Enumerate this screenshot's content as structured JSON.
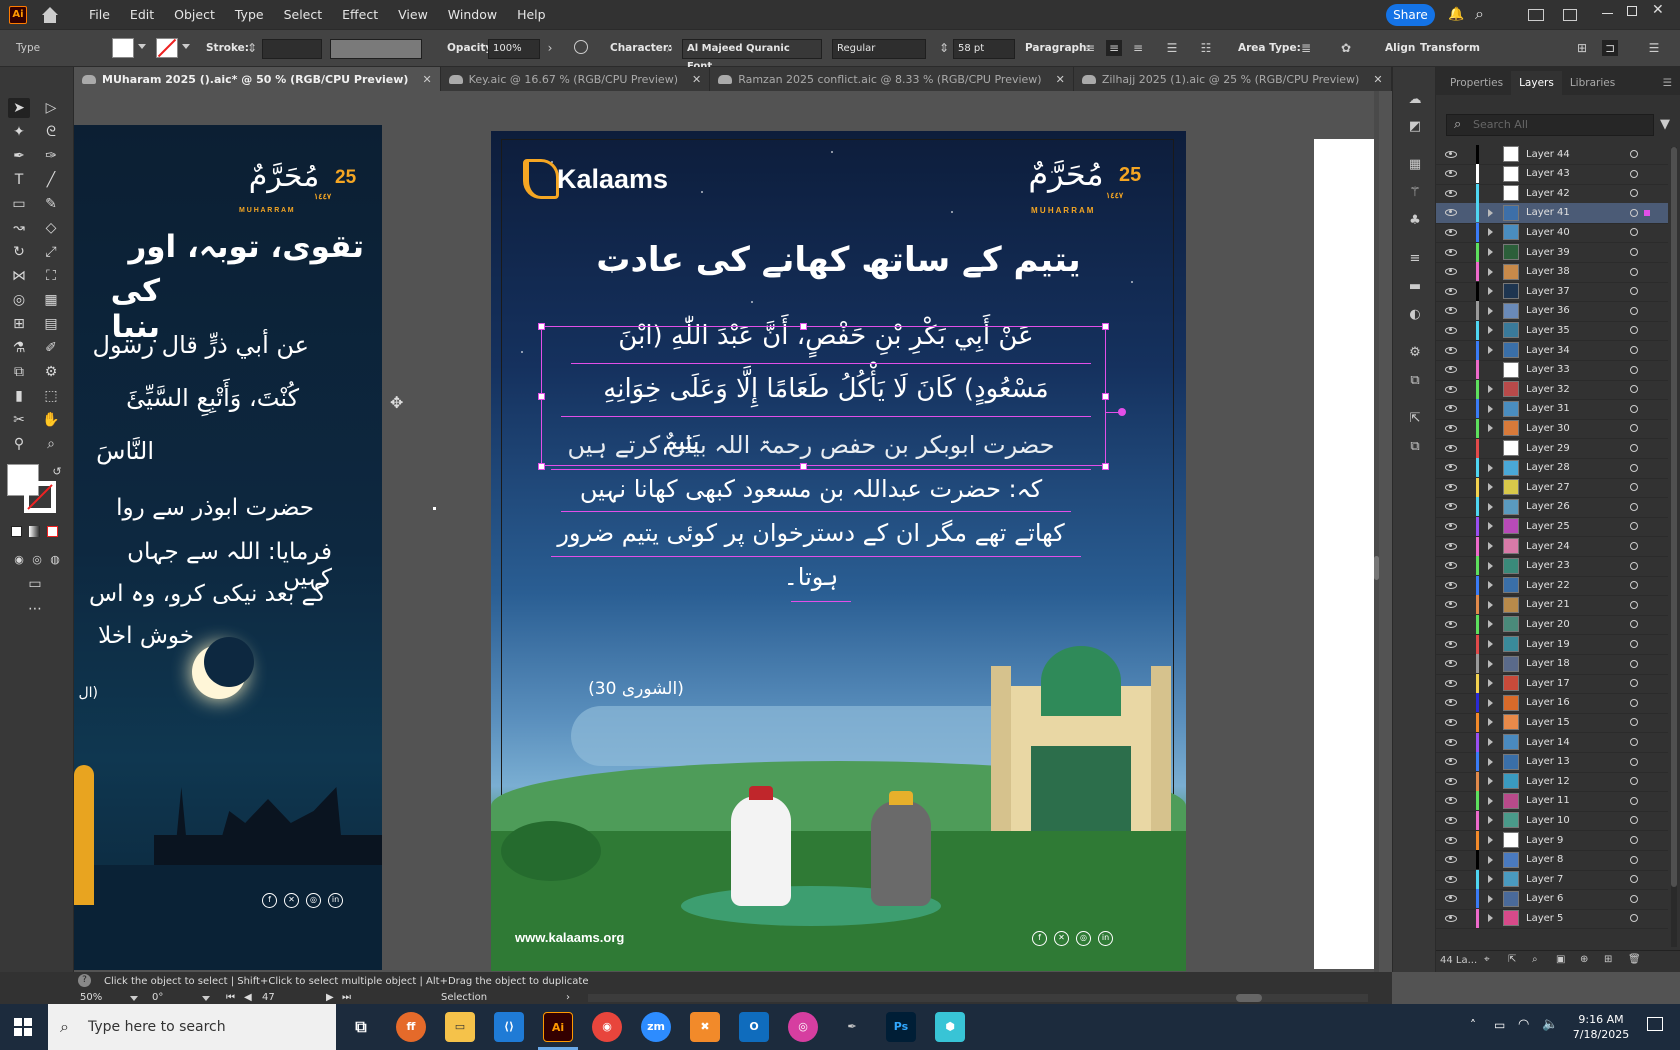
{
  "menubar": {
    "app_logo": "Ai",
    "items": [
      "File",
      "Edit",
      "Object",
      "Type",
      "Select",
      "Effect",
      "View",
      "Window",
      "Help"
    ],
    "share_label": "Share"
  },
  "controlbar": {
    "type_label": "Type",
    "stroke_label": "Stroke:",
    "opacity_label": "Opacity:",
    "opacity_value": "100%",
    "character_label": "Character:",
    "font_family": "Al Majeed Quranic Font...",
    "font_style": "Regular",
    "font_size": "58 pt",
    "paragraph_label": "Paragraph:",
    "area_type_label": "Area Type:",
    "align_label": "Align",
    "transform_label": "Transform"
  },
  "tabs": [
    {
      "label": "MUharam 2025 ().aic* @ 50 % (RGB/CPU Preview)",
      "active": true
    },
    {
      "label": "Key.aic @ 16.67 % (RGB/CPU Preview)",
      "active": false
    },
    {
      "label": "Ramzan 2025 conflict.aic @ 8.33 % (RGB/CPU Preview)",
      "active": false
    },
    {
      "label": "Zilhajj 2025 (1).aic @ 25 % (RGB/CPU Preview)",
      "active": false
    }
  ],
  "artboard_main": {
    "brand": "Kalaams",
    "month_number": "25",
    "month_arabic": "مُحَرَّمٌ",
    "month_year": "١٤٤٧",
    "month_latin": "M U H A R R A M",
    "title": "یتیم کے ساتھ کھانے کی عادت",
    "arabic_line1": "عَنْ أَبِي بَكْرِ بْنِ حَفْصٍ، أَنَّ عَبْدَ اللّٰهِ (ابْنَ",
    "arabic_line2": "مَسْعُودٍ) كَانَ لَا يَأْكُلُ طَعَامًا إِلَّا وَعَلَى خِوَانِهِ",
    "arabic_line3": "يَتِيمٌ",
    "urdu_line1": "حضرت ابوبکر بن حفص رحمۃ اللہ بیان کرتے ہیں",
    "urdu_line2": "کہ: حضرت عبداللہ بن مسعود کبھی کھانا نہیں",
    "urdu_line3": "کھاتے تھے مگر ان کے دسترخوان پر کوئی یتیم ضرور",
    "urdu_line4": "ہوتا۔",
    "reference": "(الشوری 30)",
    "website": "www.kalaams.org"
  },
  "artboard_left": {
    "month_number": "25",
    "month_arabic": "مُحَرَّمٌ",
    "month_year": "١٤٤٧",
    "month_latin": "M U H A R R A M",
    "title_line1": "تقوی، توبہ، اور",
    "title_line2": "کی بنیا",
    "arabic_line1": "عن أبي ذرٍّ قال رسول",
    "arabic_line2": "كُنْتَ، وَأَتْبِعِ السَّيِّئَ",
    "arabic_line3": "النَّاسَ",
    "urdu_line1": "حضرت ابوذر سے روا",
    "urdu_line2": "فرمایا: اللہ سے جہاں کہیں",
    "urdu_line3": "کے بعد نیکی کرو، وہ اس",
    "urdu_line4": "خوش اخلا",
    "reference": "(ال"
  },
  "panel": {
    "tabs": [
      "Properties",
      "Layers",
      "Libraries"
    ],
    "active_tab": "Layers",
    "search_placeholder": "Search All",
    "layers": [
      {
        "name": "Layer 44",
        "color": "#000000",
        "expand": false
      },
      {
        "name": "Layer 43",
        "color": "#ffffff",
        "expand": false
      },
      {
        "name": "Layer 42",
        "color": "#4fd6f2",
        "expand": false
      },
      {
        "name": "Layer 41",
        "color": "#4fd6f2",
        "expand": true,
        "active": true
      },
      {
        "name": "Layer 40",
        "color": "#3a7cf7",
        "expand": true
      },
      {
        "name": "Layer 39",
        "color": "#5ee05e",
        "expand": true
      },
      {
        "name": "Layer 38",
        "color": "#ee6acb",
        "expand": true
      },
      {
        "name": "Layer 37",
        "color": "#000000",
        "expand": true
      },
      {
        "name": "Layer 36",
        "color": "#9a9a9a",
        "expand": true
      },
      {
        "name": "Layer 35",
        "color": "#4fd6f2",
        "expand": true
      },
      {
        "name": "Layer 34",
        "color": "#3a7cf7",
        "expand": true
      },
      {
        "name": "Layer 33",
        "color": "#ee6acb",
        "expand": false
      },
      {
        "name": "Layer 32",
        "color": "#5ee05e",
        "expand": true
      },
      {
        "name": "Layer 31",
        "color": "#3a7cf7",
        "expand": true
      },
      {
        "name": "Layer 30",
        "color": "#5ee05e",
        "expand": true
      },
      {
        "name": "Layer 29",
        "color": "#e24a4a",
        "expand": false
      },
      {
        "name": "Layer 28",
        "color": "#4fd6f2",
        "expand": true
      },
      {
        "name": "Layer 27",
        "color": "#f2d24f",
        "expand": true
      },
      {
        "name": "Layer 26",
        "color": "#4fd6f2",
        "expand": true
      },
      {
        "name": "Layer 25",
        "color": "#9a4ff2",
        "expand": true
      },
      {
        "name": "Layer 24",
        "color": "#ee6acb",
        "expand": true
      },
      {
        "name": "Layer 23",
        "color": "#5ee05e",
        "expand": true
      },
      {
        "name": "Layer 22",
        "color": "#3a7cf7",
        "expand": true
      },
      {
        "name": "Layer 21",
        "color": "#e28a4a",
        "expand": true
      },
      {
        "name": "Layer 20",
        "color": "#5ee05e",
        "expand": true
      },
      {
        "name": "Layer 19",
        "color": "#e24a4a",
        "expand": true
      },
      {
        "name": "Layer 18",
        "color": "#9a9a9a",
        "expand": true
      },
      {
        "name": "Layer 17",
        "color": "#f2d24f",
        "expand": true
      },
      {
        "name": "Layer 16",
        "color": "#2a2ad6",
        "expand": true
      },
      {
        "name": "Layer 15",
        "color": "#f28a2a",
        "expand": true
      },
      {
        "name": "Layer 14",
        "color": "#9a4ff2",
        "expand": true
      },
      {
        "name": "Layer 13",
        "color": "#3a7cf7",
        "expand": true
      },
      {
        "name": "Layer 12",
        "color": "#e28a4a",
        "expand": true
      },
      {
        "name": "Layer 11",
        "color": "#5ee05e",
        "expand": true
      },
      {
        "name": "Layer 10",
        "color": "#ee6acb",
        "expand": true
      },
      {
        "name": "Layer 9",
        "color": "#f28a2a",
        "expand": true
      },
      {
        "name": "Layer 8",
        "color": "#000000",
        "expand": true
      },
      {
        "name": "Layer 7",
        "color": "#4fd6f2",
        "expand": true
      },
      {
        "name": "Layer 6",
        "color": "#3a7cf7",
        "expand": true
      },
      {
        "name": "Layer 5",
        "color": "#ee6acb",
        "expand": true
      }
    ],
    "footer_count": "44 La..."
  },
  "statusbar": {
    "hint": "Click the object to select  |  Shift+Click to select multiple object  |  Alt+Drag the object to duplicate",
    "zoom": "50%",
    "rotation": "0°",
    "artboard_number": "47",
    "tool_name": "Selection"
  },
  "taskbar": {
    "search_placeholder": "Type here to search",
    "time": "9:16 AM",
    "date": "7/18/2025"
  }
}
